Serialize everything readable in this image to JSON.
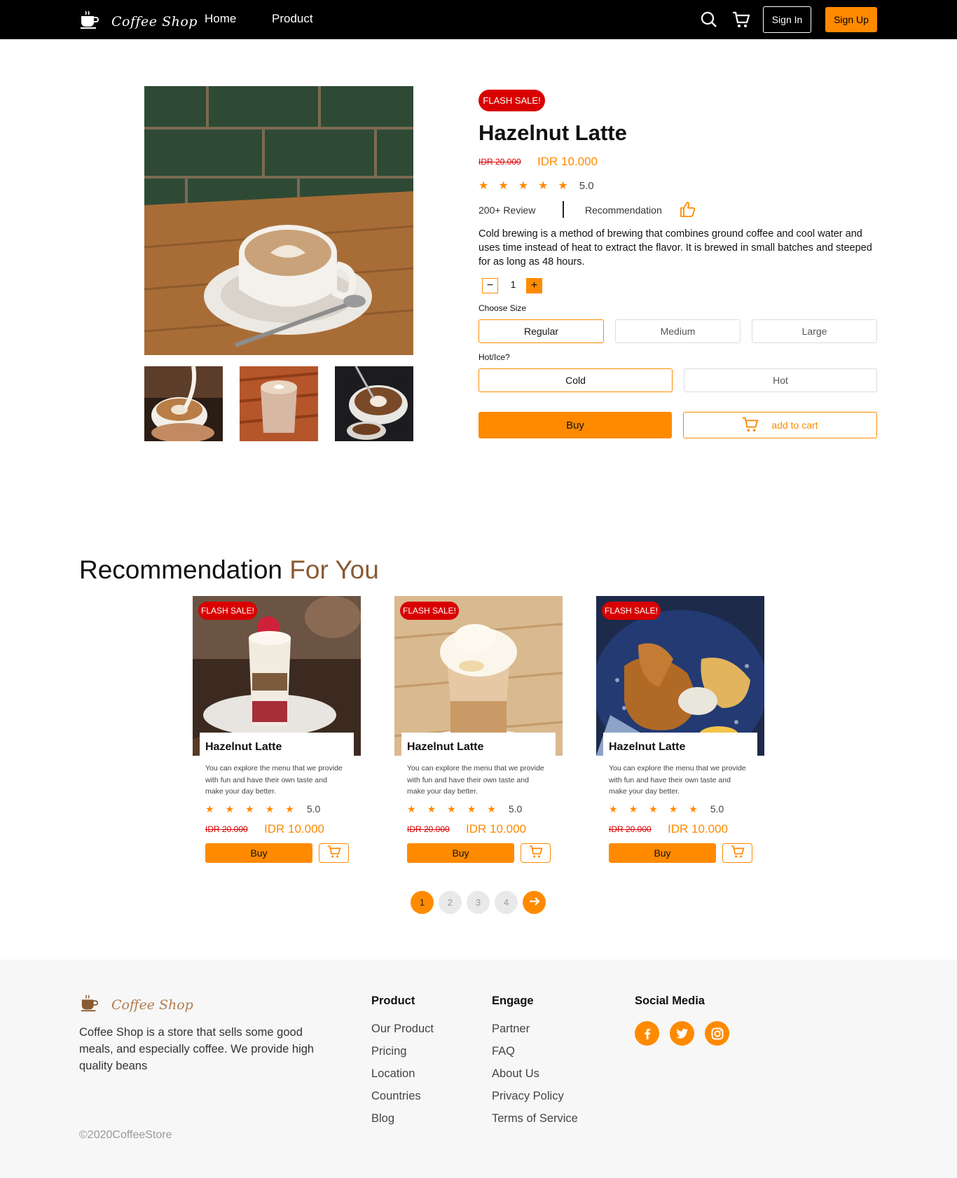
{
  "nav": {
    "brand": "Coffee Shop",
    "links": [
      "Home",
      "Product"
    ],
    "signin": "Sign In",
    "signup": "Sign Up"
  },
  "product": {
    "badge": "FLASH SALE!",
    "title": "Hazelnut Latte",
    "old_price": "IDR 20.000",
    "new_price": "IDR 10.000",
    "rating": "5.0",
    "reviews": "200+ Review",
    "recommendation": "Recommendation",
    "description": "Cold brewing is a method of brewing that combines ground coffee and cool water and uses time instead of heat to extract the flavor. It is brewed in small batches and steeped for as long as 48 hours.",
    "quantity": "1",
    "size_label": "Choose Size",
    "sizes": [
      "Regular",
      "Medium",
      "Large"
    ],
    "selected_size": "Regular",
    "temp_label": "Hot/Ice?",
    "temps": [
      "Cold",
      "Hot"
    ],
    "selected_temp": "Cold",
    "buy": "Buy",
    "add_to_cart": "add to cart"
  },
  "recommendation": {
    "title_main": "Recommendation",
    "title_accent": "For You",
    "cards": [
      {
        "badge": "FLASH SALE!",
        "name": "Hazelnut Latte",
        "desc": "You can explore the menu that we provide with fun and have their own taste and make your day better.",
        "rating": "5.0",
        "old_price": "IDR 20.000",
        "new_price": "IDR 10.000",
        "buy": "Buy"
      },
      {
        "badge": "FLASH SALE!",
        "name": "Hazelnut Latte",
        "desc": "You can explore the menu that we provide with fun and have their own taste and make your day better.",
        "rating": "5.0",
        "old_price": "IDR 20.000",
        "new_price": "IDR 10.000",
        "buy": "Buy"
      },
      {
        "badge": "FLASH SALE!",
        "name": "Hazelnut Latte",
        "desc": "You can explore the menu that we provide with fun and have their own taste and make your day better.",
        "rating": "5.0",
        "old_price": "IDR 20.000",
        "new_price": "IDR 10.000",
        "buy": "Buy"
      }
    ]
  },
  "pagination": {
    "pages": [
      "1",
      "2",
      "3",
      "4"
    ],
    "active": "1"
  },
  "footer": {
    "brand": "Coffee Shop",
    "about": "Coffee Shop is a store that sells some good meals, and especially coffee. We provide high quality beans",
    "product_head": "Product",
    "product_links": [
      "Our Product",
      "Pricing",
      "Location",
      "Countries",
      "Blog"
    ],
    "engage_head": "Engage",
    "engage_links": [
      "Partner",
      "FAQ",
      "About Us",
      "Privacy Policy",
      "Terms of Service"
    ],
    "social_head": "Social Media",
    "social_icons": [
      "facebook-icon",
      "twitter-icon",
      "instagram-icon"
    ],
    "copyright": "©2020CoffeeStore"
  },
  "colors": {
    "accent": "#ff8a00",
    "sale": "#d90000",
    "brown": "#8a5a32"
  }
}
